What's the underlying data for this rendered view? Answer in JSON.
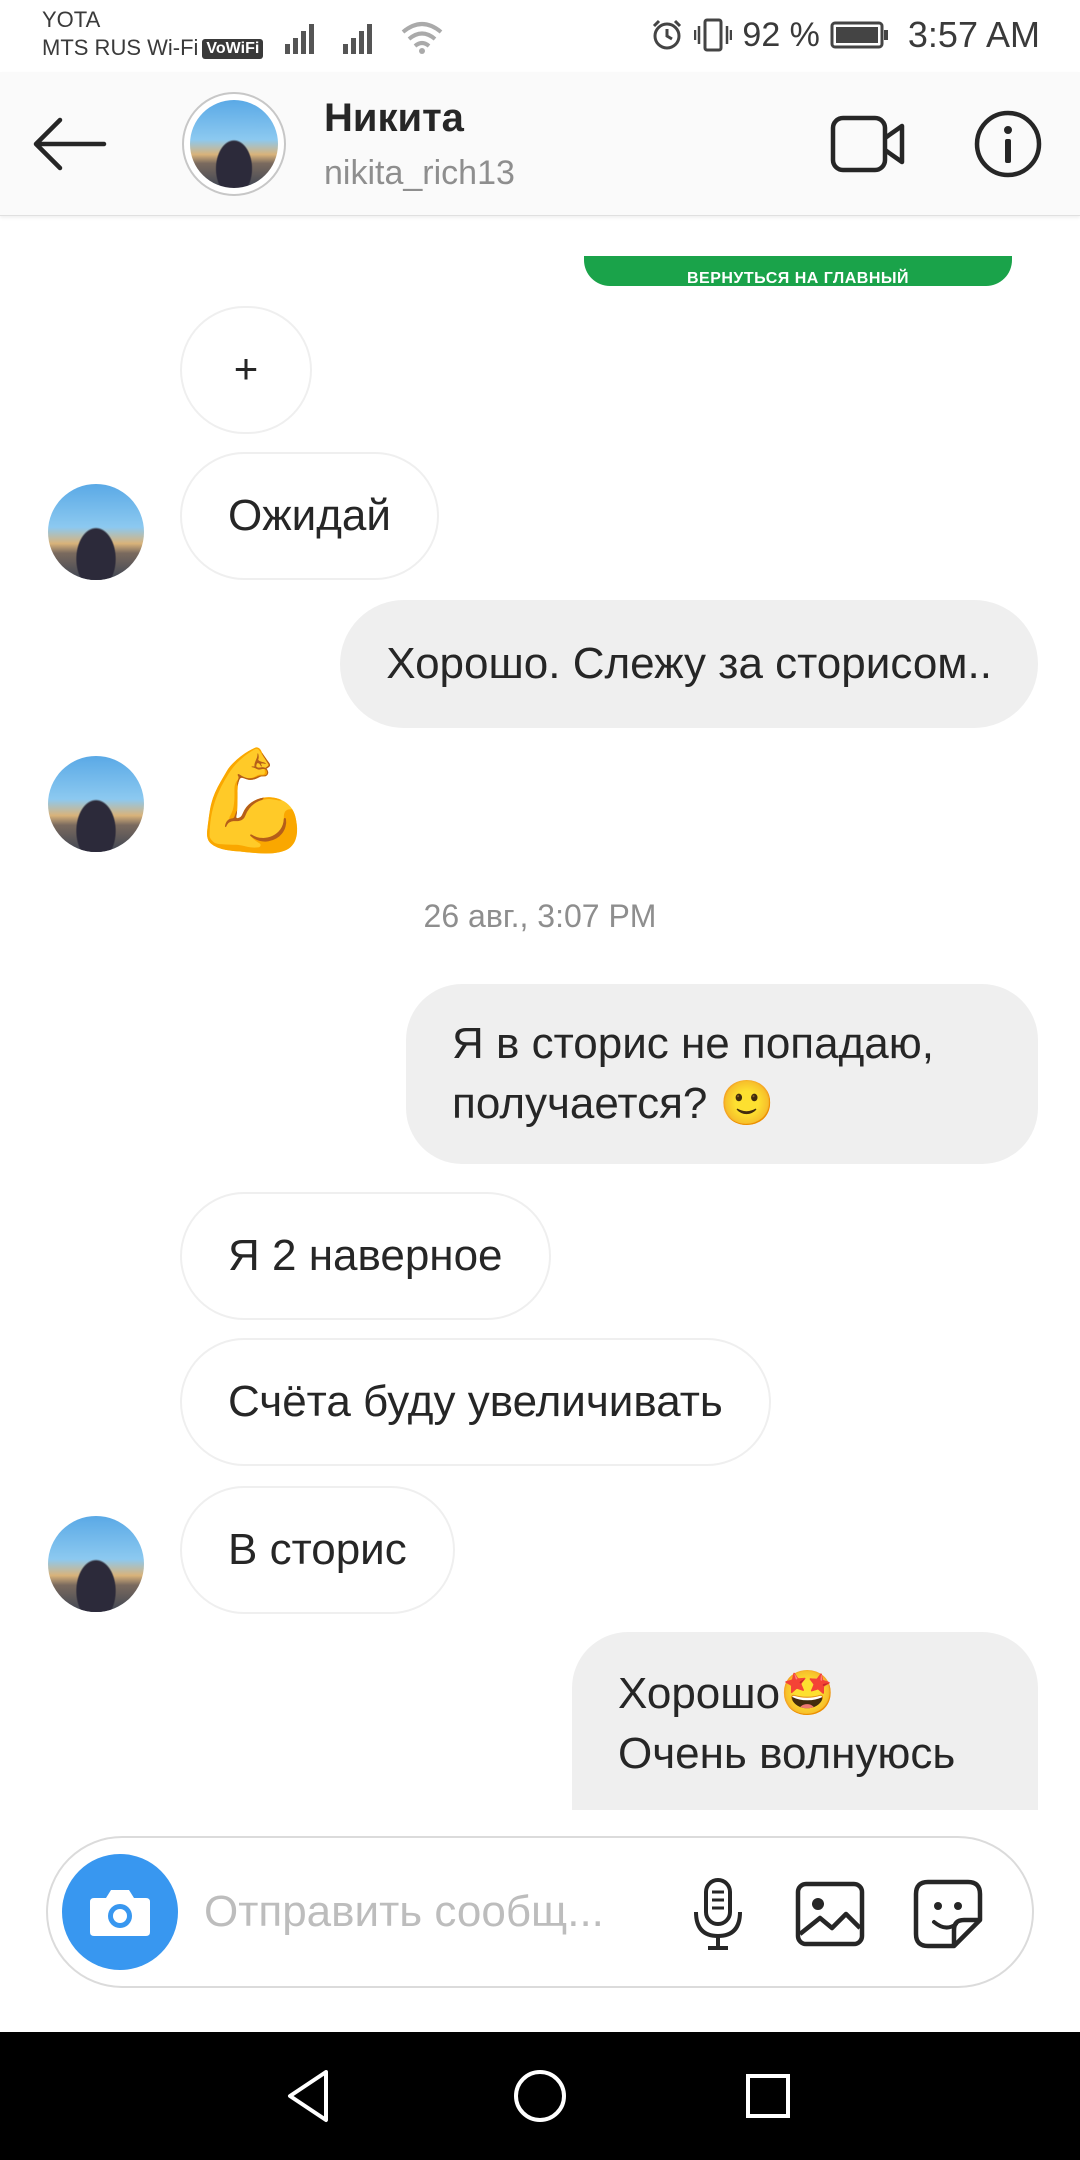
{
  "status_bar": {
    "carrier1": "YOTA",
    "carrier2": "MTS RUS Wi-Fi",
    "vowifi": "VoWiFi",
    "battery": "92 %",
    "time": "3:57 AM",
    "icons": [
      "signal-icon",
      "signal-icon",
      "wifi-icon",
      "alarm-icon",
      "vibrate-icon",
      "battery-icon"
    ]
  },
  "header": {
    "name": "Никита",
    "username": "nikita_rich13",
    "icons": [
      "back-arrow-icon",
      "video-call-icon",
      "info-icon"
    ]
  },
  "chat": {
    "cta_text": "ВЕРНУТЬСЯ НА ГЛАВНЫЙ",
    "plus_bubble": "+",
    "messages": [
      {
        "from": "them",
        "text": "Ожидай"
      },
      {
        "from": "me",
        "text": "Хорошо. Слежу за сторисом.."
      },
      {
        "from": "them",
        "text": "💪"
      },
      {
        "from": "me",
        "text": "Я в сторис не попадаю, получается? 🙂"
      },
      {
        "from": "them",
        "text": "Я 2 наверное"
      },
      {
        "from": "them",
        "text": "Счёта буду увеличивать"
      },
      {
        "from": "them",
        "text": "В сторис"
      },
      {
        "from": "me",
        "line1": "Хорошо🤩",
        "line2": "Очень волнуюсь"
      }
    ],
    "timestamp": "26 авг., 3:07 PM"
  },
  "composer": {
    "placeholder": "Отправить сообщ...",
    "icons": [
      "camera-icon",
      "microphone-icon",
      "gallery-icon",
      "sticker-icon"
    ]
  },
  "nav": {
    "icons": [
      "back-triangle-icon",
      "home-circle-icon",
      "recents-square-icon"
    ]
  },
  "colors": {
    "accent": "#3897f0",
    "out_bubble": "#efefef",
    "in_border": "#efefef",
    "cta": "#1aa34a",
    "muted": "#8e8e8e"
  }
}
